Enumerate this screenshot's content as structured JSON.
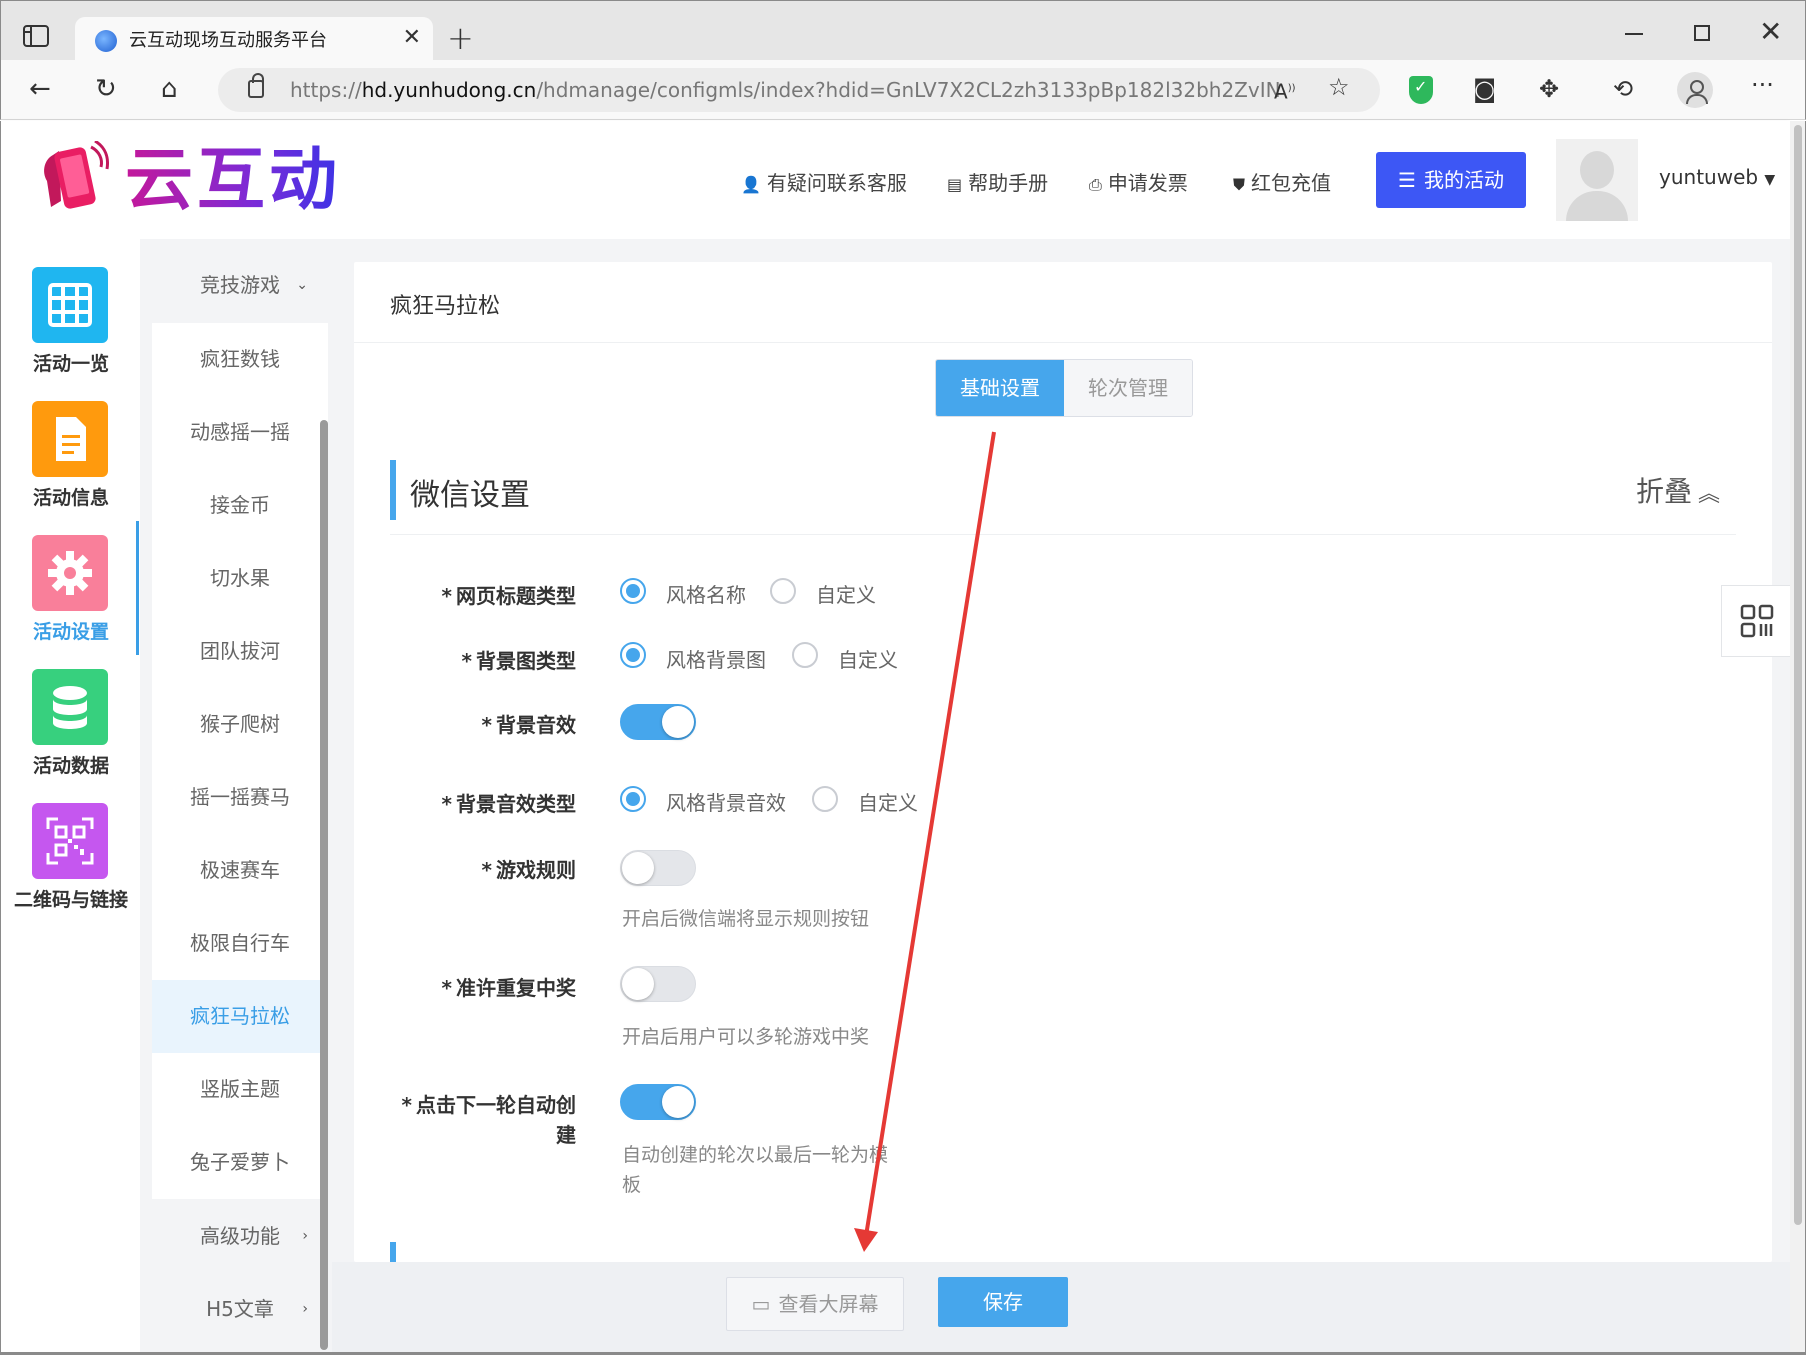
{
  "browser": {
    "tab_title": "云互动现场互动服务平台",
    "url_prefix": "https://",
    "url_host": "hd.yunhudong.cn",
    "url_path": "/hdmanage/configmls/index?hdid=GnLV7X2CL2zh3133pBp182l32bh2ZvIN"
  },
  "header": {
    "logo_text": "云互动",
    "links": [
      "有疑问联系客服",
      "帮助手册",
      "申请发票",
      "红包充值"
    ],
    "my_activity": "我的活动",
    "username": "yuntuweb"
  },
  "icon_nav": [
    {
      "label": "活动一览",
      "color": "#1fb6f0",
      "icon": "grid-icon"
    },
    {
      "label": "活动信息",
      "color": "#ff9a0d",
      "icon": "document-icon"
    },
    {
      "label": "活动设置",
      "color": "#f97f9a",
      "icon": "gear-icon"
    },
    {
      "label": "活动数据",
      "color": "#37d07e",
      "icon": "database-icon"
    },
    {
      "label": "二维码与链接",
      "color": "#c557ef",
      "icon": "qrcode-icon"
    }
  ],
  "sub_menu": {
    "group": "竞技游戏",
    "items": [
      "疯狂数钱",
      "动感摇一摇",
      "接金币",
      "切水果",
      "团队拔河",
      "猴子爬树",
      "摇一摇赛马",
      "极速赛车",
      "极限自行车",
      "疯狂马拉松",
      "竖版主题",
      "兔子爱萝卜"
    ],
    "active": "疯狂马拉松",
    "advanced": "高级功能",
    "h5": "H5文章"
  },
  "main": {
    "page_title": "疯狂马拉松",
    "tabs": [
      "基础设置",
      "轮次管理"
    ],
    "section_title": "微信设置",
    "collapse": "折叠",
    "required_mark": "*",
    "fields": {
      "page_title_type": {
        "label": "网页标题类型",
        "opt1": "风格名称",
        "opt2": "自定义"
      },
      "bg_image_type": {
        "label": "背景图类型",
        "opt1": "风格背景图",
        "opt2": "自定义"
      },
      "bg_sound": {
        "label": "背景音效"
      },
      "bg_sound_type": {
        "label": "背景音效类型",
        "opt1": "风格背景音效",
        "opt2": "自定义"
      },
      "game_rules": {
        "label": "游戏规则",
        "hint": "开启后微信端将显示规则按钮"
      },
      "repeat_win": {
        "label": "准许重复中奖",
        "hint": "开启后用户可以多轮游戏中奖"
      },
      "auto_create": {
        "label_line1": "点击下一轮自动创",
        "label_line2": "建",
        "hint_line1": "自动创建的轮次以最后一轮为模",
        "hint_line2": "板"
      }
    }
  },
  "footer": {
    "view_screen": "查看大屏幕",
    "save": "保存"
  },
  "colors": {
    "primary": "#46a6ec",
    "header_button": "#3d57f5",
    "annotation_arrow": "#e53935"
  }
}
